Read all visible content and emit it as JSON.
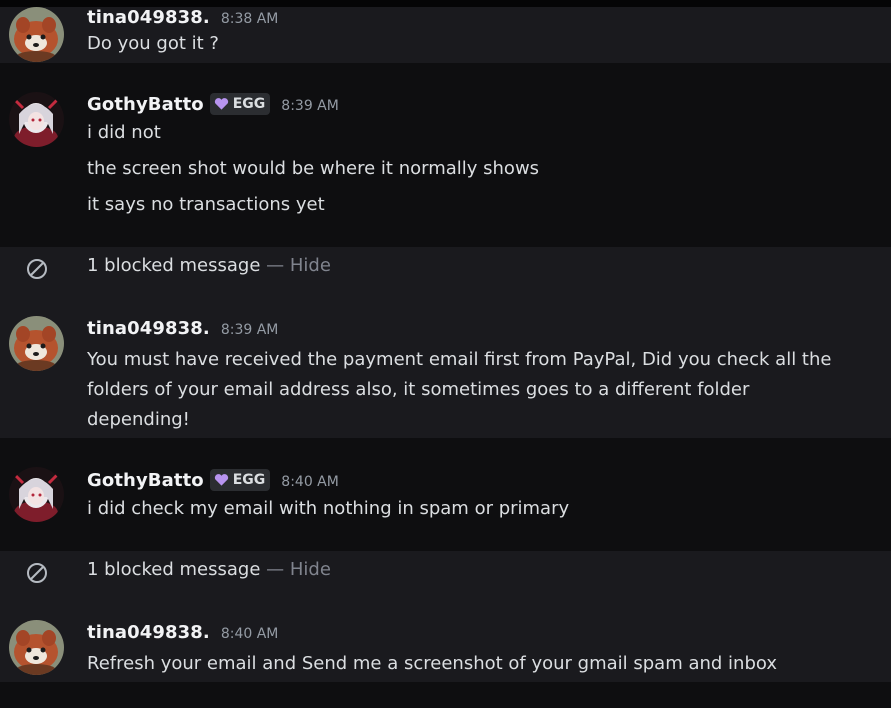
{
  "colors": {
    "background": "#0e0e10",
    "highlight_background": "#1a1a1e",
    "username": "#f2f3f5",
    "timestamp": "#949ba4",
    "text": "#dbdee1",
    "muted": "#80848e",
    "heart": "#b894f0"
  },
  "messages": [
    {
      "username": "tina049838.",
      "timestamp": "8:38 AM",
      "avatar_icon": "red-panda-avatar",
      "lines": [
        "Do you got it ?"
      ]
    },
    {
      "username": "GothyBatto",
      "badge_icon": "purple-heart-icon",
      "badge": "EGG",
      "timestamp": "8:39 AM",
      "avatar_icon": "anime-girl-avatar",
      "lines": [
        "i did not",
        "the screen shot would be where it normally shows",
        "it says no transactions yet"
      ]
    },
    {
      "username": "tina049838.",
      "timestamp": "8:39 AM",
      "avatar_icon": "red-panda-avatar",
      "lines": [
        "You must have received the payment email first from PayPal, Did you check all the",
        "folders of your email address also, it sometimes goes to a different folder",
        "depending!"
      ]
    },
    {
      "username": "GothyBatto",
      "badge_icon": "purple-heart-icon",
      "badge": "EGG",
      "timestamp": "8:40 AM",
      "avatar_icon": "anime-girl-avatar",
      "lines": [
        "i did check my email with nothing in spam or primary"
      ]
    },
    {
      "username": "tina049838.",
      "timestamp": "8:40 AM",
      "avatar_icon": "red-panda-avatar",
      "lines": [
        "Refresh your email and Send me a screenshot of your gmail spam and inbox"
      ]
    }
  ],
  "blocked": [
    {
      "icon": "blocked-icon",
      "text": "1 blocked message",
      "separator": " — ",
      "action": "Hide"
    },
    {
      "icon": "blocked-icon",
      "text": "1 blocked message",
      "separator": " — ",
      "action": "Hide"
    }
  ]
}
